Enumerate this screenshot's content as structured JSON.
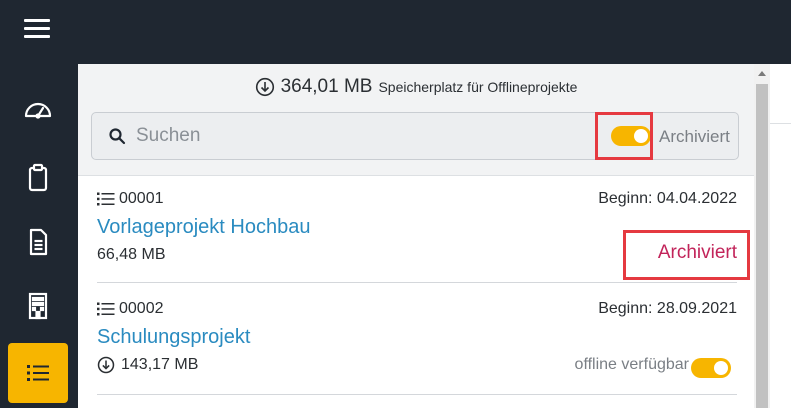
{
  "storage": {
    "amount": "364,01 MB",
    "label": "Speicherplatz für Offlineprojekte"
  },
  "search": {
    "placeholder": "Suchen"
  },
  "filter": {
    "archived_label": "Archiviert",
    "archived_on": true
  },
  "projects": [
    {
      "number": "00001",
      "start": "Beginn: 04.04.2022",
      "title": "Vorlageprojekt Hochbau",
      "size": "66,48 MB",
      "status": "Archiviert"
    },
    {
      "number": "00002",
      "start": "Beginn: 28.09.2021",
      "title": "Schulungsprojekt",
      "size": "143,17 MB",
      "offline_label": "offline verfügbar",
      "offline_on": true
    }
  ],
  "colors": {
    "accent": "#f7b500",
    "link": "#2a8bc0",
    "archived": "#c2245a",
    "highlight": "#e53940",
    "dark": "#1f2731"
  },
  "icons": {
    "menu": "hamburger-icon",
    "nav": [
      "dashboard-icon",
      "clipboard-icon",
      "document-icon",
      "building-icon",
      "list-icon"
    ]
  }
}
